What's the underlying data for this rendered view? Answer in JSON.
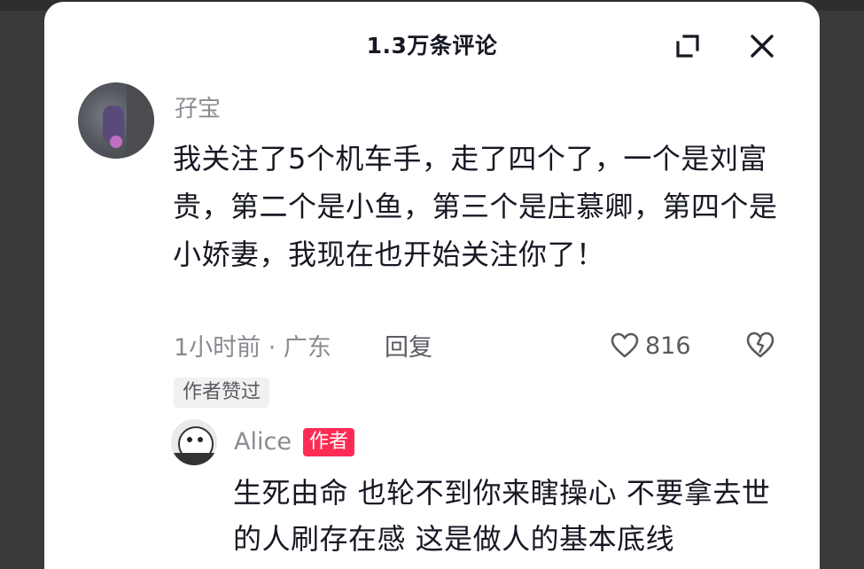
{
  "header": {
    "title": "1.3万条评论"
  },
  "comment": {
    "username": "孖宝",
    "text": "我关注了5个机车手，走了四个了，一个是刘富贵，第二个是小鱼，第三个是庄慕卿，第四个是小娇妻，我现在也开始关注你了！",
    "meta": "1小时前 · 广东",
    "reply_label": "回复",
    "like_count": "816",
    "author_liked_label": "作者赞过"
  },
  "reply": {
    "username": "Alice",
    "badge": "作者",
    "text": "生死由命 也轮不到你来瞎操心 不要拿去世的人刷存在感 这是做人的基本底线"
  },
  "colors": {
    "accent": "#fe2c55",
    "secondary_text": "#8a8b91",
    "primary_text": "#161823"
  }
}
